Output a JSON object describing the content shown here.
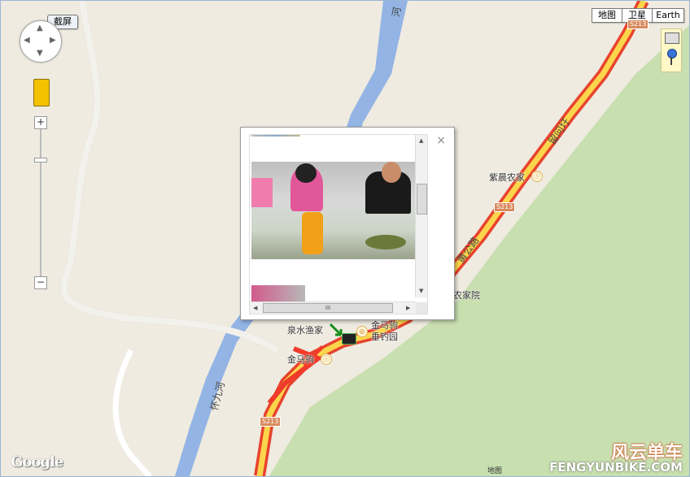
{
  "map_type_buttons": [
    "地图",
    "卫星",
    "Earth"
  ],
  "fullscreen_label": "截屏",
  "zoom": {
    "plus": "+",
    "minus": "−"
  },
  "places": {
    "zichen": "紫晨农家",
    "nongjiayuan": "农家院",
    "quanshui": "泉水渔家",
    "jinmaju": "金马驹",
    "jinmaju_yard": "金马驹\n垂钓园"
  },
  "roads": {
    "ding_road": "留问圩",
    "huang_road": "黄公路",
    "s213": "S213",
    "river_upper": "河",
    "river_lower": "怀九河"
  },
  "popup": {
    "close": "×",
    "scroll_grip": "III"
  },
  "branding": {
    "google": "Google",
    "watermark_cn": "风云单车",
    "watermark_en": "FENGYUNBIKE.COM",
    "attribution": "地图"
  },
  "colors": {
    "road_red": "#e8432e",
    "road_yellow": "#fbd54b",
    "river": "#93b4e4",
    "park": "#c8dfb0"
  }
}
